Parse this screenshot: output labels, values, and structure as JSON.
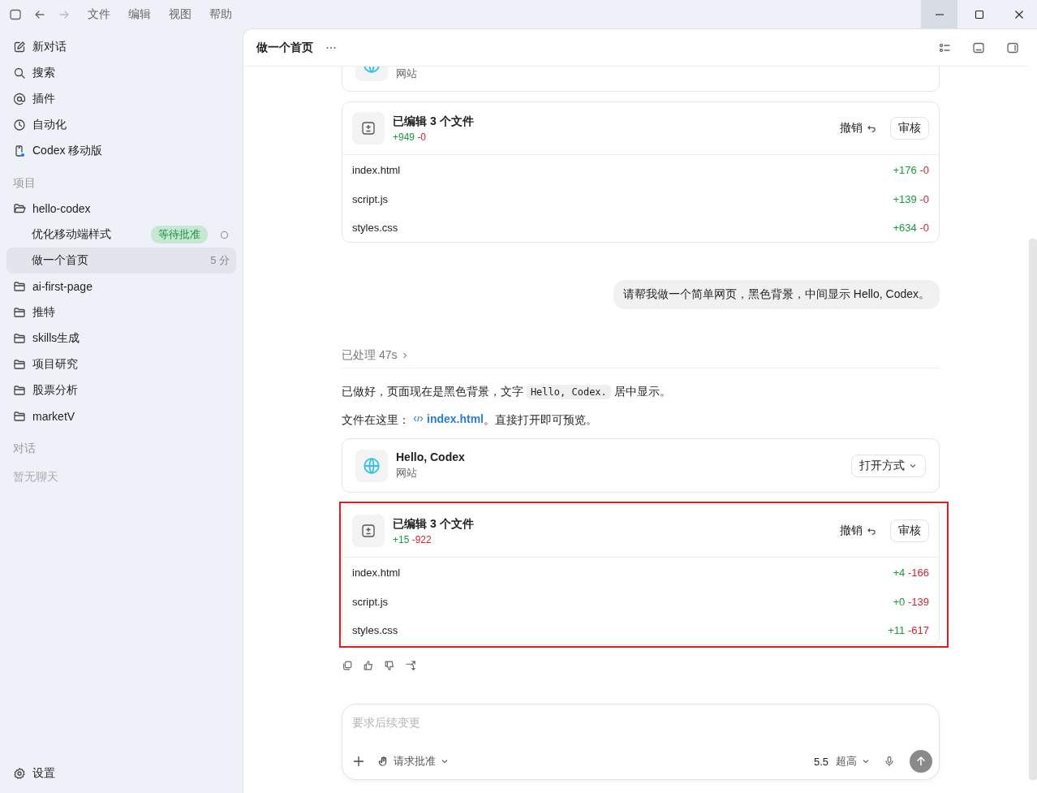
{
  "titlebar": {
    "menus": [
      "文件",
      "编辑",
      "视图",
      "帮助"
    ]
  },
  "sidebar": {
    "nav": [
      {
        "kind": "edit",
        "label": "新对话"
      },
      {
        "kind": "search",
        "label": "搜索"
      },
      {
        "kind": "at",
        "label": "插件"
      },
      {
        "kind": "clock",
        "label": "自动化"
      },
      {
        "kind": "phone",
        "label": "Codex 移动版"
      }
    ],
    "projects_heading": "项目",
    "projects": [
      {
        "name": "hello-codex",
        "expanded": true,
        "children": [
          {
            "title": "优化移动端样式",
            "badge": "等待批准",
            "loading": true,
            "selected": false
          },
          {
            "title": "做一个首页",
            "time": "5 分",
            "loading": false,
            "selected": true
          }
        ]
      },
      {
        "name": "ai-first-page",
        "expanded": false
      },
      {
        "name": "推特",
        "expanded": false
      },
      {
        "name": "skills生成",
        "expanded": false
      },
      {
        "name": "项目研究",
        "expanded": false
      },
      {
        "name": "股票分析",
        "expanded": false
      },
      {
        "name": "marketV",
        "expanded": false
      }
    ],
    "chats_heading": "对话",
    "chats_empty": "暂无聊天",
    "settings": "设置"
  },
  "header": {
    "title": "做一个首页"
  },
  "messages": [
    {
      "kind": "site_card",
      "subtitle": "网站",
      "partial": true
    },
    {
      "kind": "diff_card",
      "highlighted": false,
      "title": "已编辑 3 个文件",
      "added": "+949",
      "removed": "-0",
      "undo": "撤销",
      "review": "审核",
      "files": [
        {
          "name": "index.html",
          "added": "+176",
          "removed": "-0"
        },
        {
          "name": "script.js",
          "added": "+139",
          "removed": "-0"
        },
        {
          "name": "styles.css",
          "added": "+634",
          "removed": "-0"
        }
      ]
    },
    {
      "kind": "user",
      "text": "请帮我做一个简单网页，黑色背景，中间显示 Hello, Codex。"
    },
    {
      "kind": "processed",
      "text": "已处理 47s"
    },
    {
      "kind": "paragraph",
      "parts": [
        {
          "kind": "text",
          "text": "已做好，页面现在是黑色背景，文字 "
        },
        {
          "kind": "code",
          "text": "Hello, Codex."
        },
        {
          "kind": "text",
          "text": " 居中显示。"
        }
      ]
    },
    {
      "kind": "paragraph",
      "parts": [
        {
          "kind": "text",
          "text": "文件在这里："
        },
        {
          "kind": "link",
          "text": "index.html"
        },
        {
          "kind": "text",
          "text": "。直接打开即可预览。"
        }
      ]
    },
    {
      "kind": "site_card",
      "partial": false,
      "title": "Hello, Codex",
      "subtitle": "网站",
      "open": "打开方式"
    },
    {
      "kind": "diff_card",
      "highlighted": true,
      "title": "已编辑 3 个文件",
      "added": "+15",
      "removed": "-922",
      "undo": "撤销",
      "review": "审核",
      "files": [
        {
          "name": "index.html",
          "added": "+4",
          "removed": "-166"
        },
        {
          "name": "script.js",
          "added": "+0",
          "removed": "-139"
        },
        {
          "name": "styles.css",
          "added": "+11",
          "removed": "-617"
        }
      ]
    },
    {
      "kind": "actions"
    }
  ],
  "composer": {
    "placeholder": "要求后续变更",
    "approval": "请求批准",
    "model": "5.5",
    "effort": "超高"
  }
}
